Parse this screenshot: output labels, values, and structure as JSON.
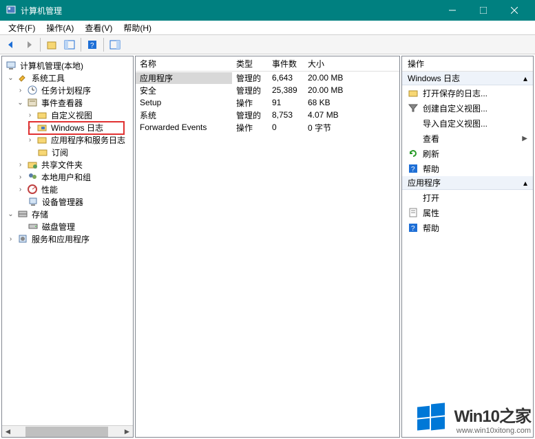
{
  "window": {
    "title": "计算机管理",
    "controls": {
      "min": "minimize",
      "max": "maximize",
      "close": "close"
    }
  },
  "menu": {
    "file": "文件(F)",
    "action": "操作(A)",
    "view": "查看(V)",
    "help": "帮助(H)"
  },
  "tree": {
    "root": "计算机管理(本地)",
    "system_tools": "系统工具",
    "task_scheduler": "任务计划程序",
    "event_viewer": "事件查看器",
    "custom_views": "自定义视图",
    "windows_logs": "Windows 日志",
    "app_service_logs": "应用程序和服务日志",
    "subscriptions": "订阅",
    "shared_folders": "共享文件夹",
    "local_users": "本地用户和组",
    "performance": "性能",
    "device_manager": "设备管理器",
    "storage": "存储",
    "disk_management": "磁盘管理",
    "services_apps": "服务和应用程序"
  },
  "list": {
    "headers": {
      "name": "名称",
      "type": "类型",
      "count": "事件数",
      "size": "大小"
    },
    "rows": [
      {
        "name": "应用程序",
        "type": "管理的",
        "count": "6,643",
        "size": "20.00 MB",
        "selected": true
      },
      {
        "name": "安全",
        "type": "管理的",
        "count": "25,389",
        "size": "20.00 MB"
      },
      {
        "name": "Setup",
        "type": "操作",
        "count": "91",
        "size": "68 KB"
      },
      {
        "name": "系统",
        "type": "管理的",
        "count": "8,753",
        "size": "4.07 MB"
      },
      {
        "name": "Forwarded Events",
        "type": "操作",
        "count": "0",
        "size": "0 字节"
      }
    ]
  },
  "actions": {
    "pane_title": "操作",
    "section1": "Windows 日志",
    "open_saved": "打开保存的日志...",
    "create_custom": "创建自定义视图...",
    "import_custom": "导入自定义视图...",
    "view": "查看",
    "refresh": "刷新",
    "help": "帮助",
    "section2": "应用程序",
    "open": "打开",
    "properties": "属性",
    "help2": "帮助"
  },
  "watermark": {
    "title": "Win10之家",
    "url": "www.win10xitong.com"
  }
}
